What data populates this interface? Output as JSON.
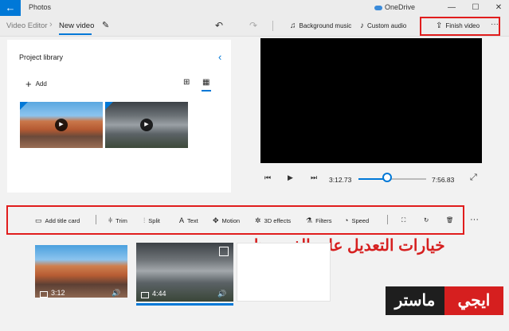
{
  "titlebar": {
    "app_title": "Photos",
    "onedrive": "OneDrive",
    "minimize": "—",
    "maximize": "☐",
    "close": "✕",
    "back": "←"
  },
  "toolbar": {
    "breadcrumb_root": "Video Editor",
    "breadcrumb_sep": "›",
    "breadcrumb_current": "New video",
    "undo": "↶",
    "redo": "↷",
    "background_music": "Background music",
    "custom_audio": "Custom audio",
    "finish_video": "Finish video",
    "more": "···"
  },
  "library": {
    "title": "Project library",
    "add_label": "Add",
    "collapse": "‹"
  },
  "player": {
    "current_time": "3:12.73",
    "end_time": "7:56.83",
    "progress": 0.41
  },
  "edit_tools": {
    "add_title_card": "Add title card",
    "trim": "Trim",
    "split": "Split",
    "text": "Text",
    "motion": "Motion",
    "effects_3d": "3D effects",
    "filters": "Filters",
    "speed": "Speed",
    "more": "···"
  },
  "storyboard": {
    "clips": [
      {
        "duration": "3:12"
      },
      {
        "duration": "4:44"
      }
    ]
  },
  "overlay": {
    "arabic_caption": "خيارات التعديل على الفيديوهات",
    "logo_left": "ماستر",
    "logo_right": "ايجي"
  },
  "colors": {
    "accent": "#0078d7",
    "highlight": "#e11d1d",
    "logo_dark": "#1e1e1e",
    "logo_red": "#d61f1f"
  }
}
